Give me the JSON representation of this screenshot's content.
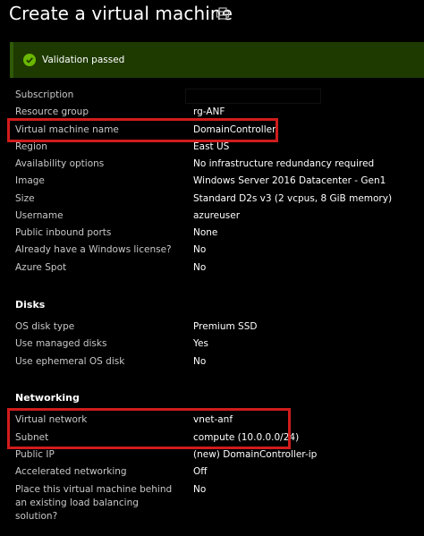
{
  "page": {
    "title": "Create a virtual machine"
  },
  "validation": {
    "text": "Validation passed",
    "color": "#1e3a00"
  },
  "basics": [
    {
      "label": "Subscription",
      "value": ""
    },
    {
      "label": "Resource group",
      "value": "rg-ANF"
    },
    {
      "label": "Virtual machine name",
      "value": "DomainController"
    },
    {
      "label": "Region",
      "value": "East US"
    },
    {
      "label": "Availability options",
      "value": "No infrastructure redundancy required"
    },
    {
      "label": "Image",
      "value": "Windows Server 2016 Datacenter - Gen1"
    },
    {
      "label": "Size",
      "value": "Standard D2s v3 (2 vcpus, 8 GiB memory)"
    },
    {
      "label": "Username",
      "value": "azureuser"
    },
    {
      "label": "Public inbound ports",
      "value": "None"
    },
    {
      "label": "Already have a Windows license?",
      "value": "No"
    },
    {
      "label": "Azure Spot",
      "value": "No"
    }
  ],
  "disks": {
    "heading": "Disks",
    "rows": [
      {
        "label": "OS disk type",
        "value": "Premium SSD"
      },
      {
        "label": "Use managed disks",
        "value": "Yes"
      },
      {
        "label": "Use ephemeral OS disk",
        "value": "No"
      }
    ]
  },
  "networking": {
    "heading": "Networking",
    "rows": [
      {
        "label": "Virtual network",
        "value": "vnet-anf"
      },
      {
        "label": "Subnet",
        "value": "compute (10.0.0.0/24)"
      },
      {
        "label": "Public IP",
        "value": "(new) DomainController-ip"
      },
      {
        "label": "Accelerated networking",
        "value": "Off"
      },
      {
        "label": "Place this virtual machine behind an existing load balancing solution?",
        "value": "No"
      }
    ]
  },
  "highlight_color": "#d01c1c"
}
